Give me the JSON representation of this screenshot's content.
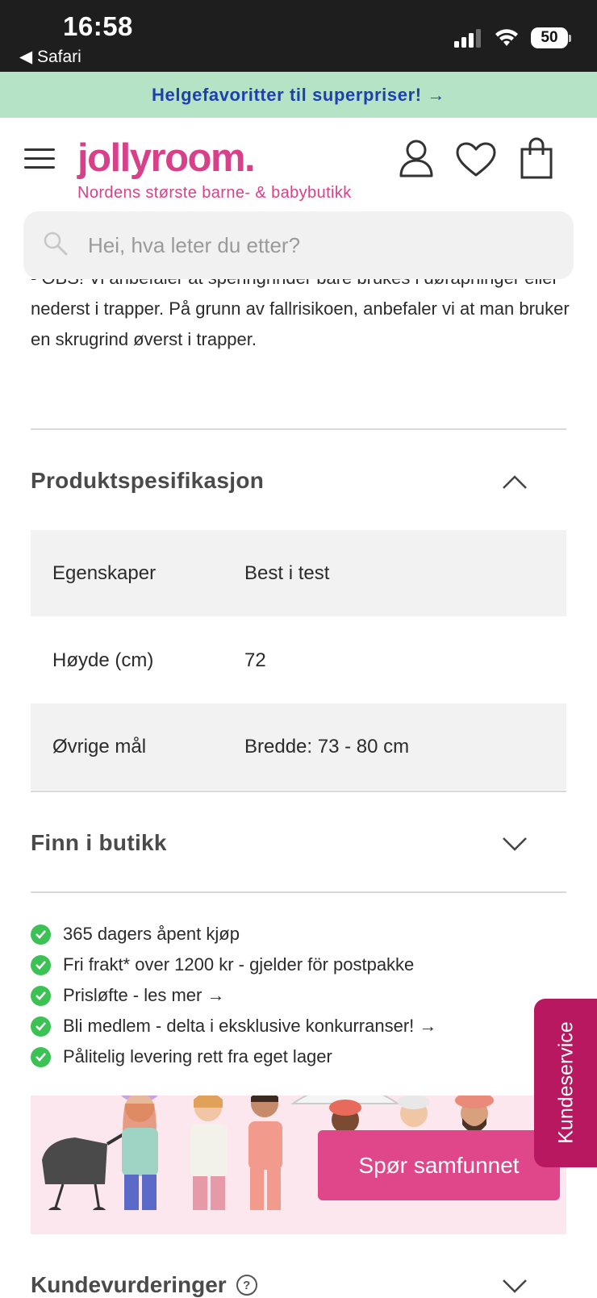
{
  "status_bar": {
    "time": "16:58",
    "back_label": "◀ Safari",
    "battery": "50"
  },
  "promo": {
    "text": "Helgefavoritter til superpriser! →"
  },
  "header": {
    "logo": "jollyroom.",
    "tagline": "Nordens største barne- & babybutikk"
  },
  "search": {
    "placeholder": "Hei, hva leter du etter?"
  },
  "description": {
    "text": "- OBS! Vi anbefaler at spenngrinder bare brukes i døråpninger eller nederst i trapper. På grunn av fallrisikoen, anbefaler vi at man bruker en skrugrind øverst i trapper."
  },
  "spec_section": {
    "title": "Produktspesifikasjon",
    "rows": [
      {
        "key": "Egenskaper",
        "value": "Best i test"
      },
      {
        "key": "Høyde (cm)",
        "value": "72"
      },
      {
        "key": "Øvrige mål",
        "value": "Bredde: 73 - 80 cm"
      }
    ]
  },
  "store_section": {
    "title": "Finn i butikk"
  },
  "usps": [
    "365 dagers åpent kjøp",
    "Fri frakt* over 1200 kr - gjelder för postpakke",
    "Prisløfte - les mer →",
    "Bli medlem - delta i eksklusive konkurranser! →",
    "Pålitelig levering rett fra eget lager"
  ],
  "community": {
    "button": "Spør samfunnet"
  },
  "kundeservice": {
    "label": "Kundeservice"
  },
  "reviews": {
    "title": "Kundevurderinger",
    "help": "?"
  },
  "colors": {
    "brand": "#d8408a",
    "promo_bg": "#b4e4c5",
    "promo_text": "#1f3fb0",
    "check": "#3cc154",
    "kundeservice": "#b8185f"
  }
}
